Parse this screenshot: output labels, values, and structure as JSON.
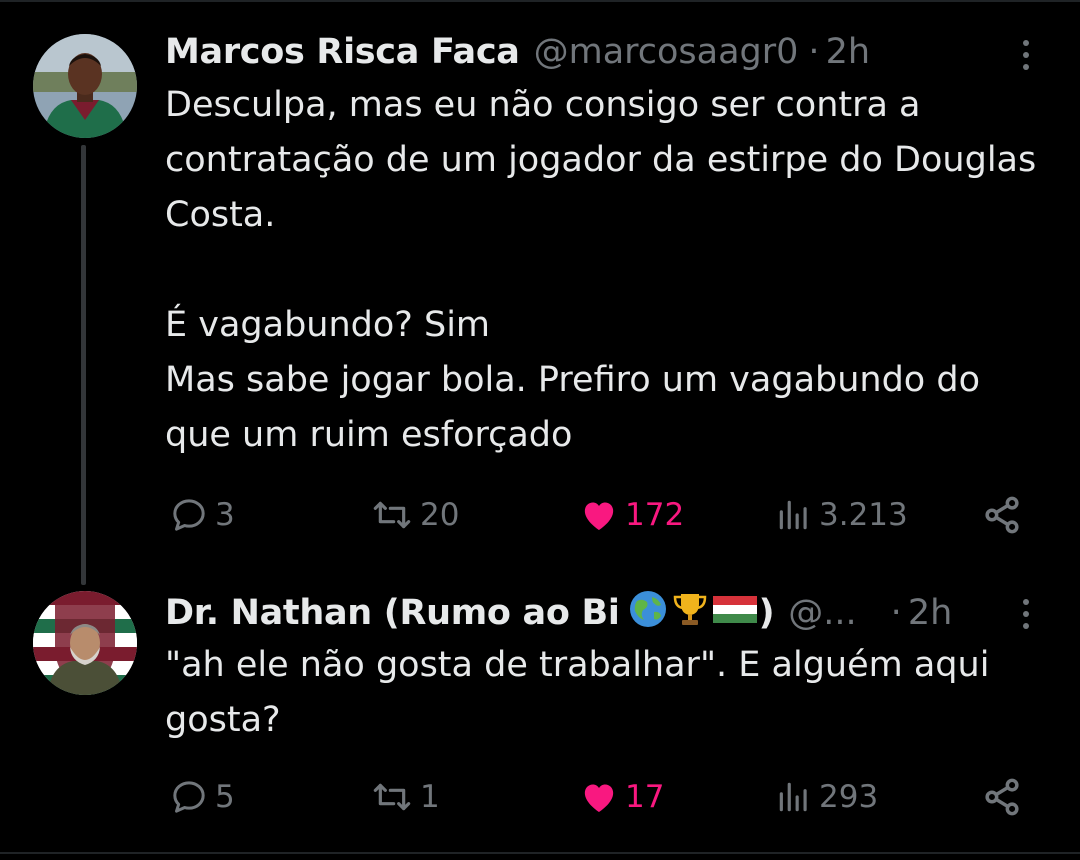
{
  "tweets": [
    {
      "author_name": "Marcos Risca Faca",
      "handle": "@marcosaagr0",
      "separator": "·",
      "time": "2h",
      "body": "Desculpa, mas eu não consigo ser contra a contratação de um jogador da estirpe do Douglas Costa.\n\nÉ vagabundo? Sim\nMas sabe jogar bola. Prefiro um vagabundo do que um ruim esforçado",
      "actions": {
        "replies": "3",
        "reposts": "20",
        "likes": "172",
        "views": "3.213"
      },
      "liked": true
    },
    {
      "author_name": "Dr. Nathan (Rumo ao Bi",
      "name_emojis": [
        "globe-icon",
        "trophy-icon",
        "hungary-flag-icon"
      ],
      "name_suffix": ")",
      "handle": "@...",
      "separator": "·",
      "time": "2h",
      "body": "\"ah ele não gosta de trabalhar\". E alguém aqui gosta?",
      "actions": {
        "replies": "5",
        "reposts": "1",
        "likes": "17",
        "views": "293"
      },
      "liked": true
    }
  ],
  "colors": {
    "background": "#000000",
    "text_primary": "#e7e9ea",
    "text_secondary": "#71767b",
    "like_active": "#f91880",
    "thread_line": "#333639"
  }
}
